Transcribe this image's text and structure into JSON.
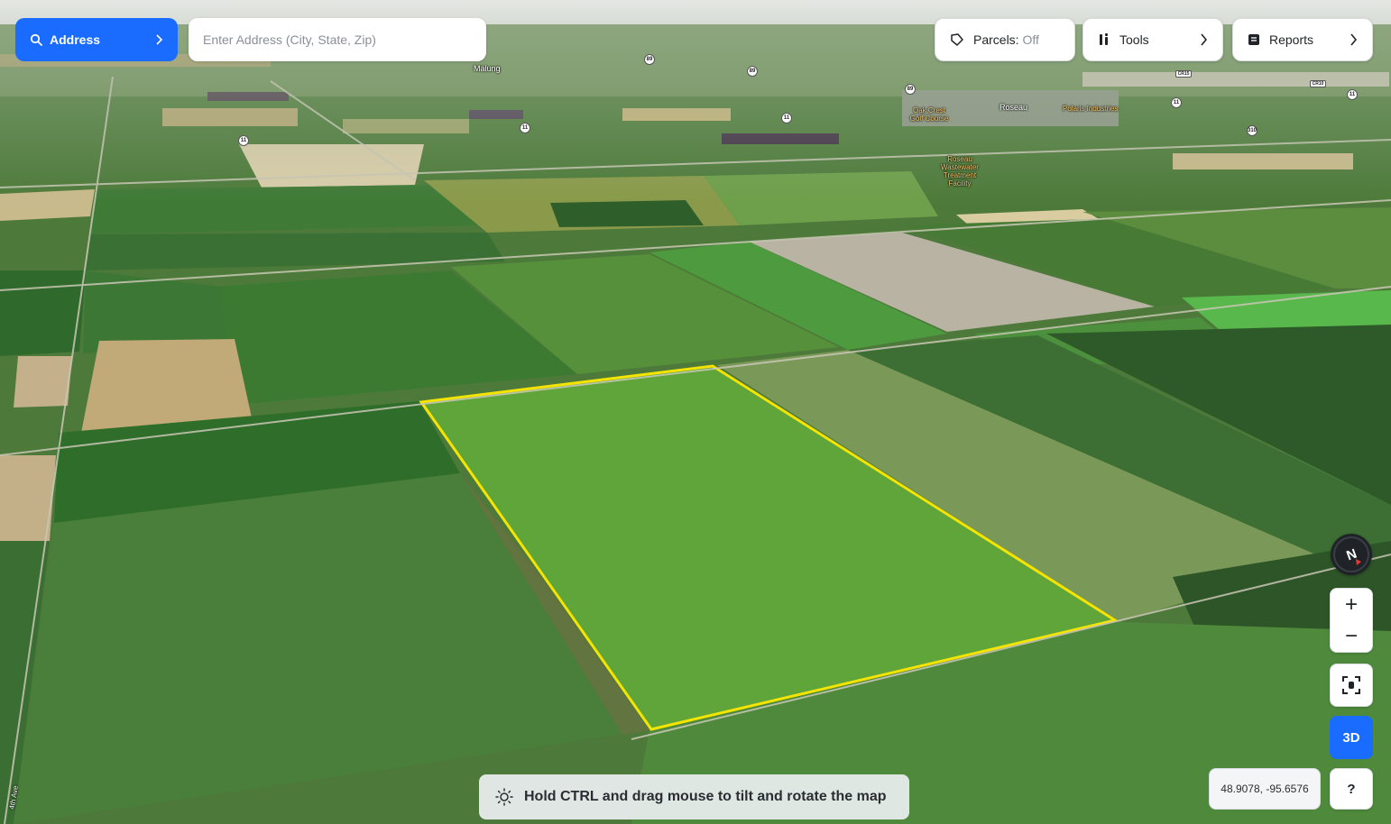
{
  "search": {
    "mode_label": "Address",
    "placeholder": "Enter Address (City, State, Zip)"
  },
  "toolbar": {
    "parcels_label": "Parcels:",
    "parcels_state": "Off",
    "tools_label": "Tools",
    "reports_label": "Reports"
  },
  "map": {
    "places": {
      "malung": "Malung",
      "roseau": "Roseau",
      "polaris": "Polaris Industries",
      "golf": "Oak Crest Golf Course",
      "wastewater": "Roseau Wastewater Treatment Facility",
      "road_west": "4th Ave"
    },
    "route_shields": [
      "89",
      "89",
      "89",
      "11",
      "11",
      "11",
      "11",
      "310",
      "11",
      "CR15",
      "CR10"
    ],
    "selected_parcel_color": "#f5e400"
  },
  "controls": {
    "compass_label": "N",
    "zoom_in": "+",
    "zoom_out": "−",
    "three_d_label": "3D",
    "help_label": "?",
    "coordinates": "48.9078, -95.6576"
  },
  "hint": {
    "text": "Hold CTRL and drag mouse to tilt and rotate the map"
  },
  "colors": {
    "accent": "#1a6bff",
    "panel_bg": "#ffffff"
  }
}
